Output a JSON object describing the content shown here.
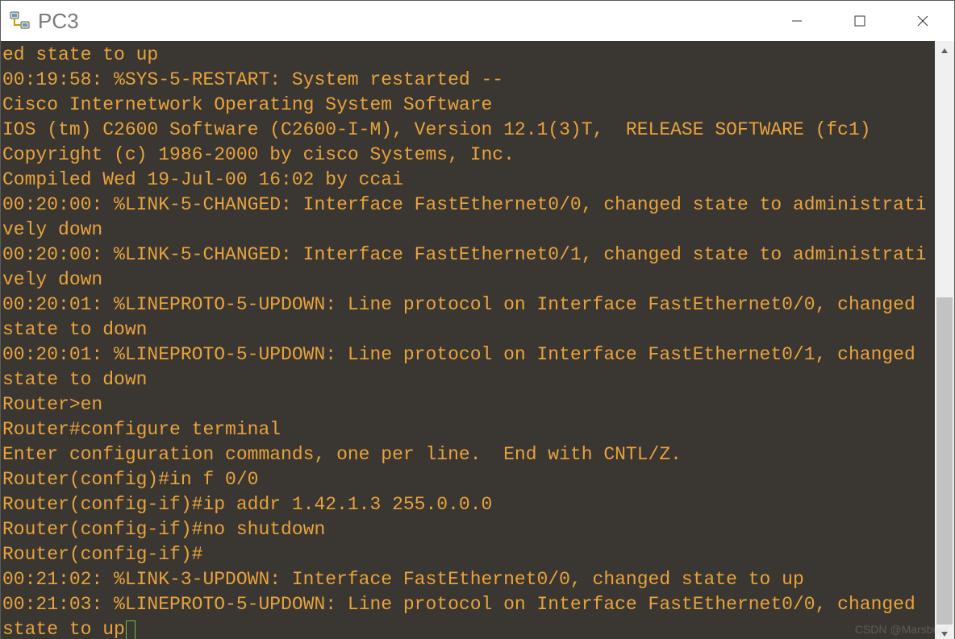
{
  "window": {
    "title": "PC3",
    "controls": {
      "minimize": "minimize",
      "maximize": "maximize",
      "close": "close"
    }
  },
  "terminal": {
    "lines": [
      "ed state to up",
      "00:19:58: %SYS-5-RESTART: System restarted --",
      "Cisco Internetwork Operating System Software",
      "IOS (tm) C2600 Software (C2600-I-M), Version 12.1(3)T,  RELEASE SOFTWARE (fc1)",
      "Copyright (c) 1986-2000 by cisco Systems, Inc.",
      "Compiled Wed 19-Jul-00 16:02 by ccai",
      "00:20:00: %LINK-5-CHANGED: Interface FastEthernet0/0, changed state to administratively down",
      "00:20:00: %LINK-5-CHANGED: Interface FastEthernet0/1, changed state to administratively down",
      "00:20:01: %LINEPROTO-5-UPDOWN: Line protocol on Interface FastEthernet0/0, changed state to down",
      "00:20:01: %LINEPROTO-5-UPDOWN: Line protocol on Interface FastEthernet0/1, changed state to down",
      "Router>en",
      "Router#configure terminal",
      "Enter configuration commands, one per line.  End with CNTL/Z.",
      "Router(config)#in f 0/0",
      "Router(config-if)#ip addr 1.42.1.3 255.0.0.0",
      "Router(config-if)#no shutdown",
      "Router(config-if)#",
      "00:21:02: %LINK-3-UPDOWN: Interface FastEthernet0/0, changed state to up",
      "00:21:03: %LINEPROTO-5-UPDOWN: Line protocol on Interface FastEthernet0/0, changed state to up"
    ]
  },
  "watermark": "CSDN @Marsbupt"
}
